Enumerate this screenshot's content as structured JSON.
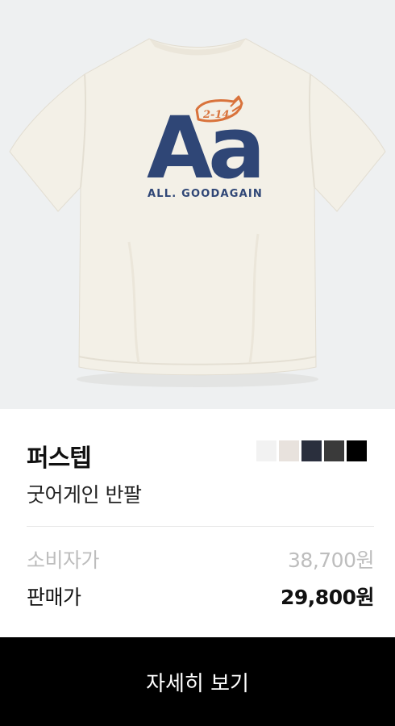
{
  "product": {
    "brand": "퍼스텝",
    "name": "굿어게인 반팔",
    "print_text": {
      "big_letters": "Aa",
      "badge": "2-14",
      "slogan": "ALL. GOODAGAIN"
    },
    "colors": {
      "background": "#eef0f1",
      "shirt": "#f3f0e7",
      "print_navy": "#2f4676",
      "print_orange": "#d9733c"
    },
    "swatches": [
      {
        "name": "white",
        "color": "#f2f2f2"
      },
      {
        "name": "ivory",
        "color": "#e8e2dd"
      },
      {
        "name": "navy",
        "color": "#2a2f3d"
      },
      {
        "name": "charcoal",
        "color": "#3a3a3a"
      },
      {
        "name": "black",
        "color": "#000000"
      }
    ]
  },
  "pricing": {
    "consumer_label": "소비자가",
    "consumer_price": "38,700원",
    "sale_label": "판매가",
    "sale_price": "29,800원"
  },
  "action": {
    "detail_label": "자세히 보기"
  }
}
